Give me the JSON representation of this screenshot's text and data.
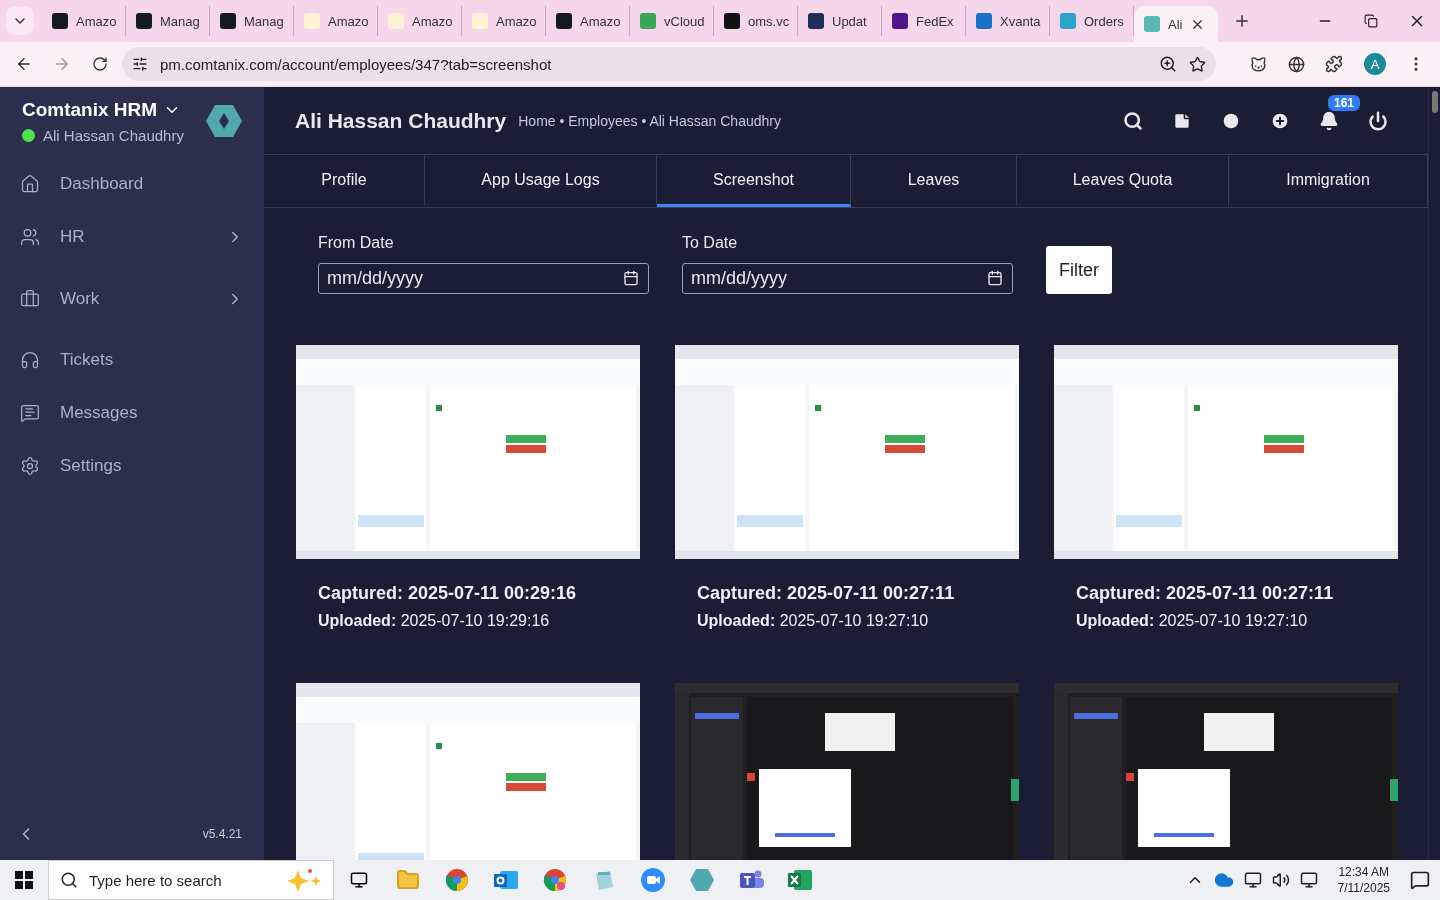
{
  "browser": {
    "tabs": [
      {
        "title": "Amazo",
        "color": "#131921",
        "selected": false
      },
      {
        "title": "Manag",
        "color": "#131921",
        "selected": false
      },
      {
        "title": "Manag",
        "color": "#131921",
        "selected": false
      },
      {
        "title": "Amazo",
        "color": "#fff3d6",
        "selected": false
      },
      {
        "title": "Amazo",
        "color": "#fff3d6",
        "selected": false
      },
      {
        "title": "Amazo",
        "color": "#fff3d6",
        "selected": false
      },
      {
        "title": "Amazo",
        "color": "#131921",
        "selected": false
      },
      {
        "title": "vCloud",
        "color": "#3aa757",
        "selected": false
      },
      {
        "title": "oms.vc",
        "color": "#111111",
        "selected": false
      },
      {
        "title": "Updat",
        "color": "#1f2d5a",
        "selected": false
      },
      {
        "title": "FedEx",
        "color": "#4d148c",
        "selected": false
      },
      {
        "title": "Xvanta",
        "color": "#1a73c8",
        "selected": false
      },
      {
        "title": "Orders",
        "color": "#2aa5c9",
        "selected": false
      },
      {
        "title": "Ali",
        "color": "#5bb8b8",
        "selected": true
      }
    ],
    "address": "pm.comtanix.com/account/employees/347?tab=screenshot",
    "profile": "A"
  },
  "sidebar": {
    "brand": "Comtanix HRM",
    "user": "Ali Hassan Chaudhry",
    "online": true,
    "items": [
      {
        "label": "Dashboard",
        "kind": "home",
        "expandable": false
      },
      {
        "label": "HR",
        "kind": "people",
        "expandable": true
      },
      {
        "label": "Work",
        "kind": "briefcase",
        "expandable": true
      },
      {
        "label": "Tickets",
        "kind": "headset",
        "expandable": false
      },
      {
        "label": "Messages",
        "kind": "message",
        "expandable": false
      },
      {
        "label": "Settings",
        "kind": "gear",
        "expandable": false
      }
    ],
    "version": "v5.4.21"
  },
  "header": {
    "title": "Ali Hassan Chaudhry",
    "breadcrumb": "Home • Employees • Ali Hassan Chaudhry",
    "notifications": "161"
  },
  "tabs": [
    {
      "label": "Profile",
      "selected": false
    },
    {
      "label": "App Usage Logs",
      "selected": false
    },
    {
      "label": "Screenshot",
      "selected": true
    },
    {
      "label": "Leaves",
      "selected": false
    },
    {
      "label": "Leaves Quota",
      "selected": false
    },
    {
      "label": "Immigration",
      "selected": false
    }
  ],
  "filter": {
    "from_label": "From Date",
    "from_placeholder": "mm/dd/yyyy",
    "to_label": "To Date",
    "to_placeholder": "mm/dd/yyyy",
    "button": "Filter"
  },
  "screenshots": [
    {
      "kind": "picture",
      "captured": "Captured: 2025-07-11 00:29:16",
      "uploaded": "**Uploaded:** 2025-07-10 19:29:16"
    },
    {
      "kind": "picture",
      "captured": "Captured: 2025-07-11 00:27:11",
      "uploaded": "**Uploaded:** 2025-07-10 19:27:10"
    },
    {
      "kind": "picture",
      "captured": "Captured: 2025-07-11 00:27:11",
      "uploaded": "**Uploaded:** 2025-07-10 19:27:10"
    },
    {
      "kind": "picture"
    },
    {
      "kind": "picture"
    },
    {
      "kind": "picture"
    }
  ],
  "taskbar": {
    "search_placeholder": "Type here to search",
    "time": "12:34 AM",
    "date": "7/11/2025"
  }
}
